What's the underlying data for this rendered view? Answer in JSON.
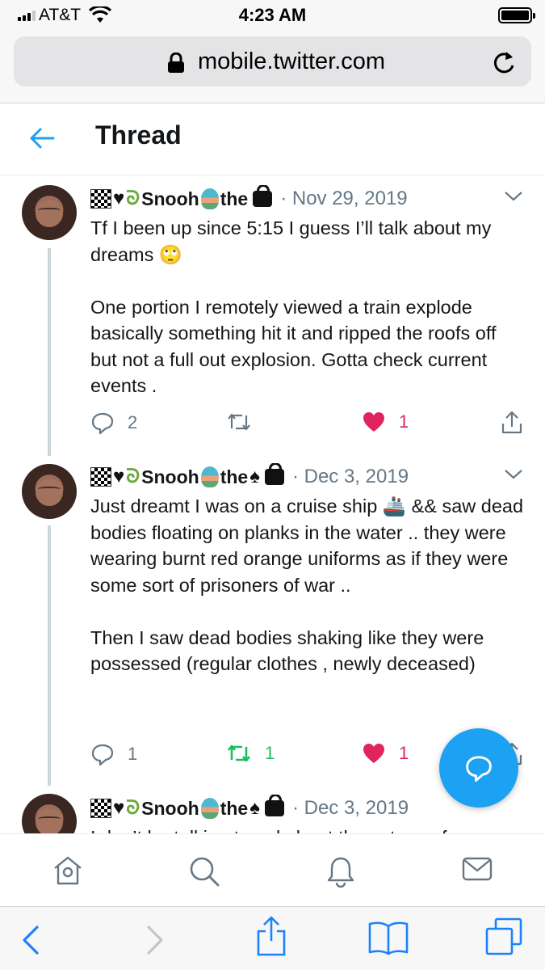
{
  "status_bar": {
    "carrier": "AT&T",
    "time": "4:23 AM"
  },
  "browser": {
    "url": "mobile.twitter.com"
  },
  "header": {
    "title": "Thread"
  },
  "tweets": [
    {
      "name": "Snooh",
      "name_suffix": "the",
      "date": "· Nov 29, 2019",
      "paragraph_1": "Tf I been up since 5:15 I guess I’ll talk about my dreams 🙄",
      "paragraph_2": "One portion I remotely viewed a train explode basically something hit it and ripped the roofs off but not a full out explosion. Gotta check current events .",
      "replies": "2",
      "retweets": "",
      "likes": "1"
    },
    {
      "name": "Snooh",
      "name_suffix": "the",
      "date": "· Dec 3, 2019",
      "paragraph_1": "Just dreamt I was on a cruise ship 🚢 && saw dead bodies floating on planks in the water .. they were wearing burnt red orange uniforms as if they were some sort of prisoners of war ..",
      "paragraph_2": "Then I saw dead bodies shaking like they were possessed (regular clothes , newly deceased)",
      "replies": "1",
      "retweets": "1",
      "likes": "1"
    },
    {
      "name": "Snooh",
      "name_suffix": "the",
      "date": "· Dec 3, 2019",
      "paragraph_1": "I don’t be talking to ppl about these type of"
    }
  ],
  "colors": {
    "twitter_blue": "#1da1f2",
    "like_red": "#e0245e",
    "retweet_green": "#17bf63",
    "muted": "#657786"
  }
}
